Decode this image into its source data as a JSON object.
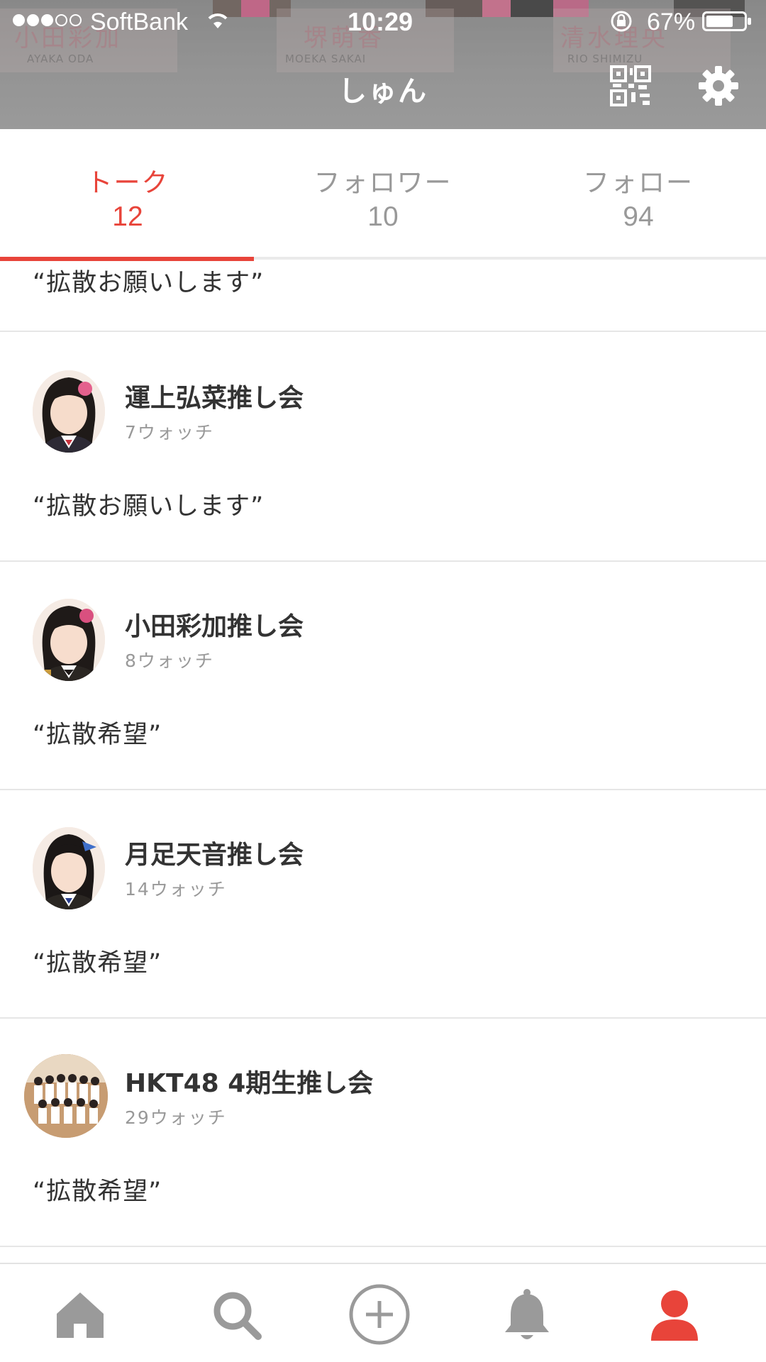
{
  "status_bar": {
    "carrier": "SoftBank",
    "time": "10:29",
    "battery": "67%"
  },
  "header": {
    "title": "しゅん",
    "cover_names": [
      {
        "kanji": "小田彩加",
        "romaji": "AYAKA ODA"
      },
      {
        "kanji": "堺萌香",
        "romaji": "MOEKA SAKAI"
      },
      {
        "kanji": "清水理央",
        "romaji": "RIO SHIMIZU"
      }
    ],
    "icons": {
      "qr": "qr-code-icon",
      "settings": "gear-icon"
    }
  },
  "tabs": [
    {
      "label": "トーク",
      "count": "12",
      "active": true
    },
    {
      "label": "フォロワー",
      "count": "10",
      "active": false
    },
    {
      "label": "フォロー",
      "count": "94",
      "active": false
    }
  ],
  "feed": {
    "partial_quote": "“拡散お願いします”",
    "items": [
      {
        "title": "運上弘菜推し会",
        "watch": "7ウォッチ",
        "quote": "“拡散お願いします”"
      },
      {
        "title": "小田彩加推し会",
        "watch": "8ウォッチ",
        "quote": "“拡散希望”"
      },
      {
        "title": "月足天音推し会",
        "watch": "14ウォッチ",
        "quote": "“拡散希望”"
      },
      {
        "title": "HKT48 4期生推し会",
        "watch": "29ウォッチ",
        "quote": "“拡散希望”"
      }
    ]
  },
  "bottom_nav": {
    "items": [
      "home-icon",
      "search-icon",
      "add-circle-icon",
      "bell-icon",
      "profile-icon"
    ],
    "active_index": 4,
    "active_color": "#e8443a",
    "inactive_color": "#9a9a9a"
  },
  "colors": {
    "accent": "#e8443a"
  }
}
